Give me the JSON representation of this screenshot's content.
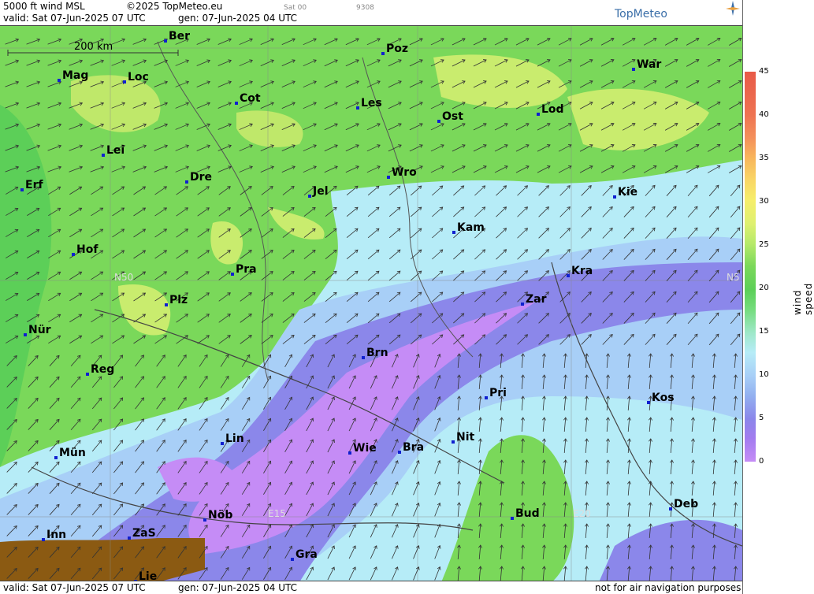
{
  "header": {
    "product": "5000 ft wind MSL",
    "copyright": "©2025 TopMeteo.eu",
    "day_code": "Sat 00",
    "code": "9308",
    "valid": "valid:  Sat  07-Jun-2025  07 UTC",
    "generated": "gen: 07-Jun-2025 04 UTC",
    "logo": "TopMeteo"
  },
  "footer": {
    "valid": "valid:  Sat  07-Jun-2025  07 UTC",
    "generated": "gen: 07-Jun-2025 04 UTC",
    "note": "not for air navigation purposes"
  },
  "scale_bar": "200 km",
  "gridlabels": {
    "n50_left": "N50",
    "n50_right": "N5",
    "e15": "E15",
    "e20": "E20"
  },
  "legend": {
    "label": "wind  speed  [kt]",
    "ticks": [
      "45",
      "40",
      "35",
      "30",
      "25",
      "20",
      "15",
      "10",
      "5",
      "0"
    ]
  },
  "cities": [
    {
      "name": "Ber"
    },
    {
      "name": "Poz"
    },
    {
      "name": "War"
    },
    {
      "name": "Mag"
    },
    {
      "name": "Loc"
    },
    {
      "name": "Cot"
    },
    {
      "name": "Les"
    },
    {
      "name": "Ost"
    },
    {
      "name": "Lod"
    },
    {
      "name": "Lei"
    },
    {
      "name": "Erf"
    },
    {
      "name": "Dre"
    },
    {
      "name": "Wro"
    },
    {
      "name": "Jel"
    },
    {
      "name": "Kie"
    },
    {
      "name": "Kam"
    },
    {
      "name": "Hof"
    },
    {
      "name": "Pra"
    },
    {
      "name": "Kra"
    },
    {
      "name": "Plz"
    },
    {
      "name": "Zar"
    },
    {
      "name": "Nür"
    },
    {
      "name": "Brn"
    },
    {
      "name": "Reg"
    },
    {
      "name": "Pri"
    },
    {
      "name": "Kos"
    },
    {
      "name": "Lin"
    },
    {
      "name": "Nit"
    },
    {
      "name": "Mün"
    },
    {
      "name": "Wie"
    },
    {
      "name": "Bra"
    },
    {
      "name": "Nöb"
    },
    {
      "name": "Bud"
    },
    {
      "name": "Deb"
    },
    {
      "name": "Inn"
    },
    {
      "name": "ZaS"
    },
    {
      "name": "Gra"
    },
    {
      "name": "Lie"
    }
  ]
}
